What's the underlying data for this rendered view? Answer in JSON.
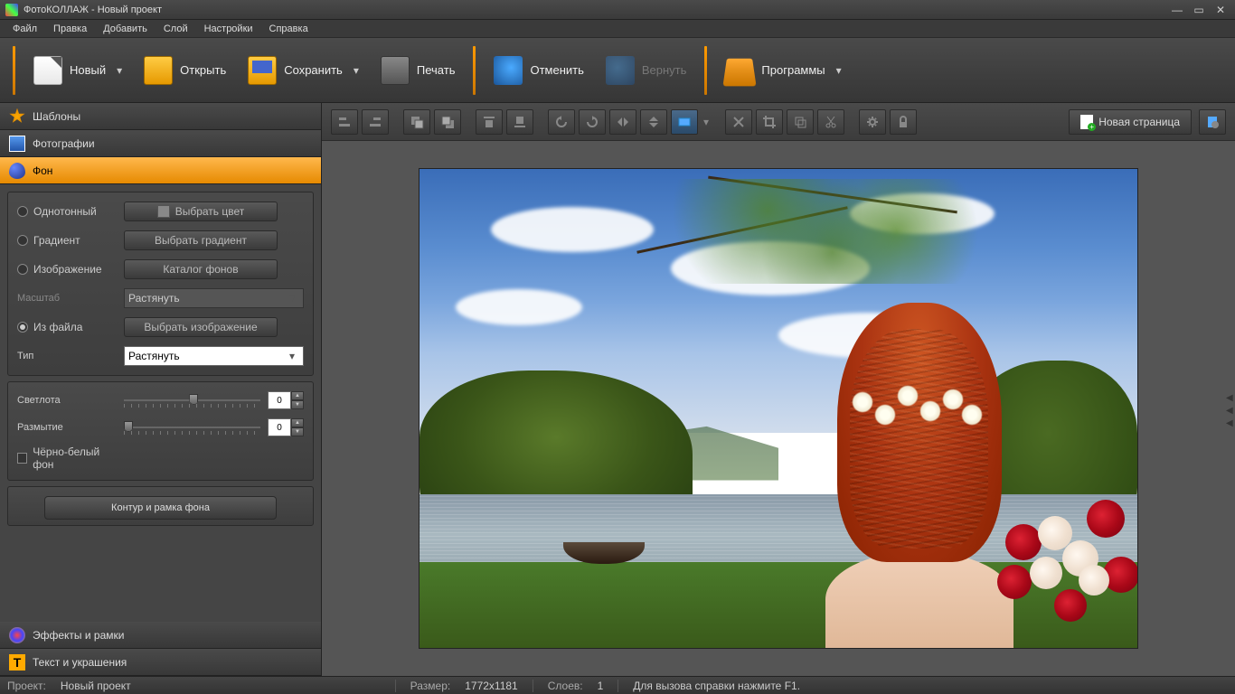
{
  "title": "ФотоКОЛЛАЖ - Новый проект",
  "menubar": [
    "Файл",
    "Правка",
    "Добавить",
    "Слой",
    "Настройки",
    "Справка"
  ],
  "toolbar": {
    "new": "Новый",
    "open": "Открыть",
    "save": "Сохранить",
    "print": "Печать",
    "undo": "Отменить",
    "redo": "Вернуть",
    "programs": "Программы"
  },
  "sidebar": {
    "templates": "Шаблоны",
    "photos": "Фотографии",
    "background": "Фон",
    "effects": "Эффекты и рамки",
    "text": "Текст и украшения"
  },
  "bg_panel": {
    "solid": "Однотонный",
    "choose_color": "Выбрать цвет",
    "gradient": "Градиент",
    "choose_gradient": "Выбрать градиент",
    "image": "Изображение",
    "catalog": "Каталог фонов",
    "scale": "Масштаб",
    "scale_value": "Растянуть",
    "from_file": "Из файла",
    "choose_image": "Выбрать изображение",
    "type": "Тип",
    "type_value": "Растянуть",
    "brightness": "Светлота",
    "brightness_value": "0",
    "blur": "Размытие",
    "blur_value": "0",
    "bw": "Чёрно-белый фон",
    "contour": "Контур и рамка фона"
  },
  "canvas_toolbar": {
    "new_page": "Новая страница"
  },
  "statusbar": {
    "project_label": "Проект:",
    "project_value": "Новый проект",
    "size_label": "Размер:",
    "size_value": "1772x1181",
    "layers_label": "Слоев:",
    "layers_value": "1",
    "help": "Для вызова справки нажмите F1."
  }
}
